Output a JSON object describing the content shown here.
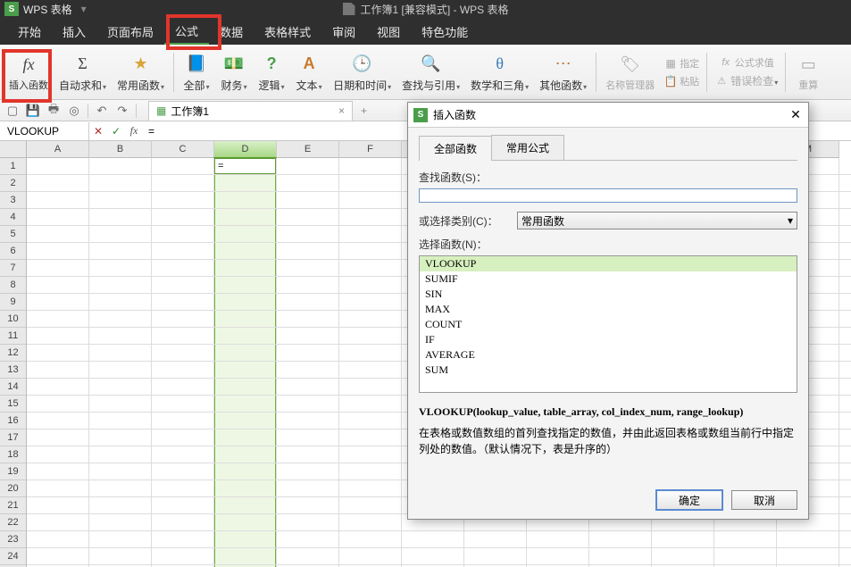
{
  "app": {
    "name": "WPS 表格",
    "doc_title": "工作簿1 [兼容模式] - WPS 表格"
  },
  "menu": {
    "items": [
      "开始",
      "插入",
      "页面布局",
      "公式",
      "数据",
      "表格样式",
      "审阅",
      "视图",
      "特色功能"
    ],
    "active_index": 3
  },
  "ribbon": {
    "insert_fn": "插入函数",
    "autosum": "自动求和",
    "common": "常用函数",
    "all": "全部",
    "finance": "财务",
    "logic": "逻辑",
    "text": "文本",
    "datetime": "日期和时间",
    "lookup": "查找与引用",
    "math": "数学和三角",
    "other": "其他函数",
    "name_mgr": "名称管理器",
    "assign": "指定",
    "paste": "粘贴",
    "fn_eval": "公式求值",
    "err_check": "错误检查",
    "recalc": "重算"
  },
  "qa": {
    "doc_tab": "工作簿1"
  },
  "formula_bar": {
    "name_box": "VLOOKUP",
    "value": "="
  },
  "grid": {
    "cols": [
      "A",
      "B",
      "C",
      "D",
      "E",
      "F",
      "",
      "",
      "",
      "",
      "",
      "",
      "M"
    ],
    "selected_col_index": 3,
    "active_cell_row": 0,
    "active_cell_text": "=",
    "row_count": 24
  },
  "dialog": {
    "title": "插入函数",
    "tabs": [
      "全部函数",
      "常用公式"
    ],
    "active_tab": 0,
    "search_label": "查找函数(S)：",
    "category_label": "或选择类别(C)：",
    "category_value": "常用函数",
    "select_fn_label": "选择函数(N)：",
    "fn_list": [
      "VLOOKUP",
      "SUMIF",
      "SIN",
      "MAX",
      "COUNT",
      "IF",
      "AVERAGE",
      "SUM"
    ],
    "fn_selected_index": 0,
    "fn_sig": "VLOOKUP(lookup_value, table_array, col_index_num, range_lookup)",
    "fn_desc": "在表格或数值数组的首列查找指定的数值，并由此返回表格或数组当前行中指定列处的数值。（默认情况下，表是升序的）",
    "ok": "确定",
    "cancel": "取消"
  }
}
